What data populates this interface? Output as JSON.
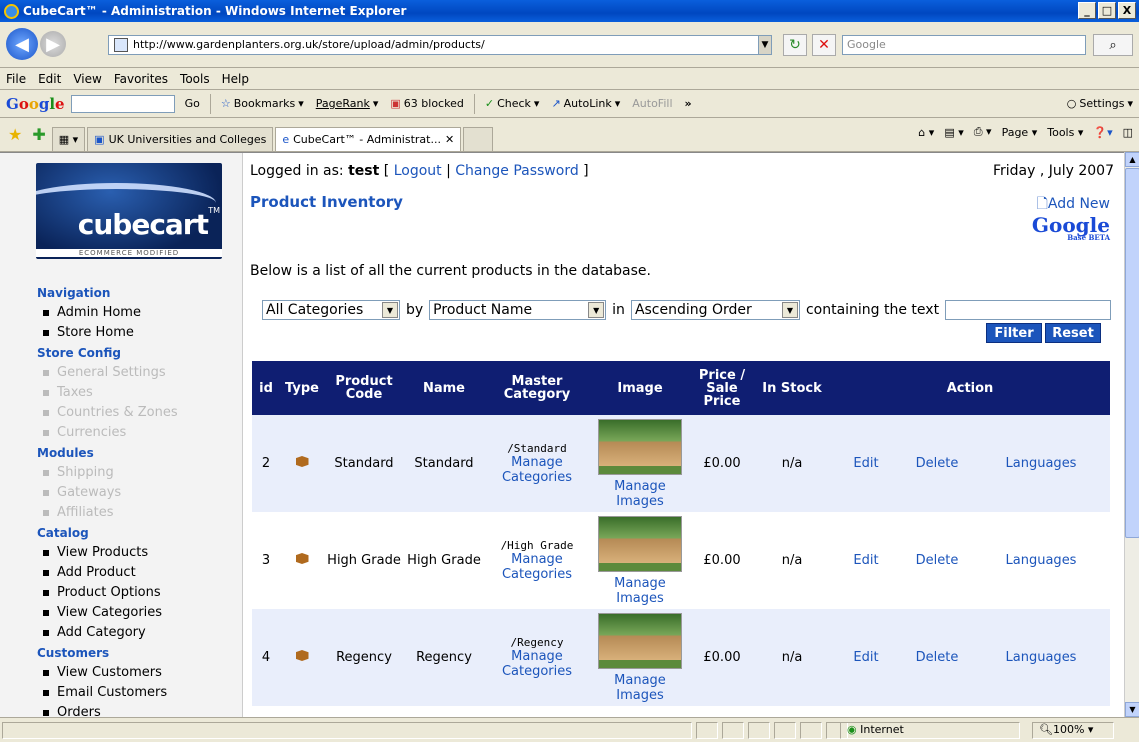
{
  "window": {
    "title": "CubeCart™ - Administration - Windows Internet Explorer",
    "buttons": [
      "_",
      "□",
      "X"
    ]
  },
  "address_bar": {
    "url": "http://www.gardenplanters.org.uk/store/upload/admin/products/",
    "search_placeholder": "Google"
  },
  "menu": {
    "items": [
      "File",
      "Edit",
      "View",
      "Favorites",
      "Tools",
      "Help"
    ]
  },
  "google_toolbar": {
    "go": "Go",
    "bookmarks": "Bookmarks",
    "pagerank": "PageRank",
    "blocked": "63 blocked",
    "check": "Check",
    "autolink": "AutoLink",
    "autofill": "AutoFill",
    "more": "»",
    "settings": "Settings"
  },
  "tabs": {
    "items": [
      "UK Universities and Colleges",
      "CubeCart™ - Administrat..."
    ],
    "page_menu": "Page",
    "tools_menu": "Tools"
  },
  "status_bar": {
    "zone": "Internet",
    "zoom": "100%"
  },
  "sidebar": {
    "logo_text": "cubecart",
    "logo_tm": "TM",
    "logo_sub": "ECOMMERCE MODIFIED",
    "sections": [
      {
        "title": "Navigation",
        "items": [
          {
            "label": "Admin Home",
            "enabled": true
          },
          {
            "label": "Store Home",
            "enabled": true
          }
        ]
      },
      {
        "title": "Store Config",
        "items": [
          {
            "label": "General Settings",
            "enabled": false
          },
          {
            "label": "Taxes",
            "enabled": false
          },
          {
            "label": "Countries & Zones",
            "enabled": false
          },
          {
            "label": "Currencies",
            "enabled": false
          }
        ]
      },
      {
        "title": "Modules",
        "items": [
          {
            "label": "Shipping",
            "enabled": false
          },
          {
            "label": "Gateways",
            "enabled": false
          },
          {
            "label": "Affiliates",
            "enabled": false
          }
        ]
      },
      {
        "title": "Catalog",
        "items": [
          {
            "label": "View Products",
            "enabled": true
          },
          {
            "label": "Add Product",
            "enabled": true
          },
          {
            "label": "Product Options",
            "enabled": true
          },
          {
            "label": "View Categories",
            "enabled": true
          },
          {
            "label": "Add Category",
            "enabled": true
          }
        ]
      },
      {
        "title": "Customers",
        "items": [
          {
            "label": "View Customers",
            "enabled": true
          },
          {
            "label": "Email Customers",
            "enabled": true
          },
          {
            "label": "Orders",
            "enabled": true
          }
        ]
      }
    ]
  },
  "header": {
    "logged_in_prefix": "Logged in as: ",
    "username": "test",
    "logout": "Logout",
    "change_password": "Change Password",
    "date": "Friday , July 2007"
  },
  "page": {
    "title": "Product Inventory",
    "add_new": "Add New",
    "google_base": "Google",
    "google_base_sub": "Base BETA",
    "intro": "Below is a list of all the current products in the database."
  },
  "filter": {
    "category": "All Categories",
    "by_label": "by",
    "sort_field": "Product Name",
    "in_label": "in",
    "order": "Ascending Order",
    "containing_label": "containing the text",
    "text_value": "",
    "filter_button": "Filter",
    "reset_button": "Reset"
  },
  "table": {
    "headers": [
      "id",
      "Type",
      "Product Code",
      "Name",
      "Master Category",
      "Image",
      "Price / Sale Price",
      "In Stock",
      "Action"
    ],
    "manage_categories": "Manage Categories",
    "manage_images": "Manage Images",
    "edit": "Edit",
    "delete": "Delete",
    "languages": "Languages",
    "rows": [
      {
        "id": "2",
        "code": "Standard",
        "name": "Standard",
        "category": "/Standard",
        "price": "£0.00",
        "stock": "n/a"
      },
      {
        "id": "3",
        "code": "High Grade",
        "name": "High Grade",
        "category": "/High Grade",
        "price": "£0.00",
        "stock": "n/a"
      },
      {
        "id": "4",
        "code": "Regency",
        "name": "Regency",
        "category": "/Regency",
        "price": "£0.00",
        "stock": "n/a"
      }
    ]
  }
}
